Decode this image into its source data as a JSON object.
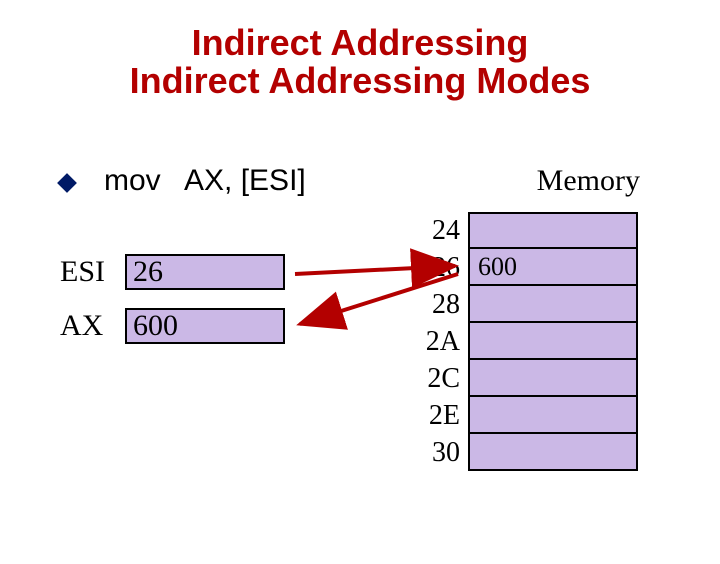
{
  "title_line1": "Indirect Addressing",
  "title_line2": "Indirect Addressing Modes",
  "instruction": "mov   AX, [ESI]",
  "memory_label": "Memory",
  "registers": {
    "esi": {
      "label": "ESI",
      "value": "26"
    },
    "ax": {
      "label": "AX",
      "value": "600"
    }
  },
  "memory": {
    "rows": [
      {
        "addr": "24",
        "value": ""
      },
      {
        "addr": "26",
        "value": "600"
      },
      {
        "addr": "28",
        "value": ""
      },
      {
        "addr": "2A",
        "value": ""
      },
      {
        "addr": "2C",
        "value": ""
      },
      {
        "addr": "2E",
        "value": ""
      },
      {
        "addr": "30",
        "value": ""
      }
    ]
  }
}
